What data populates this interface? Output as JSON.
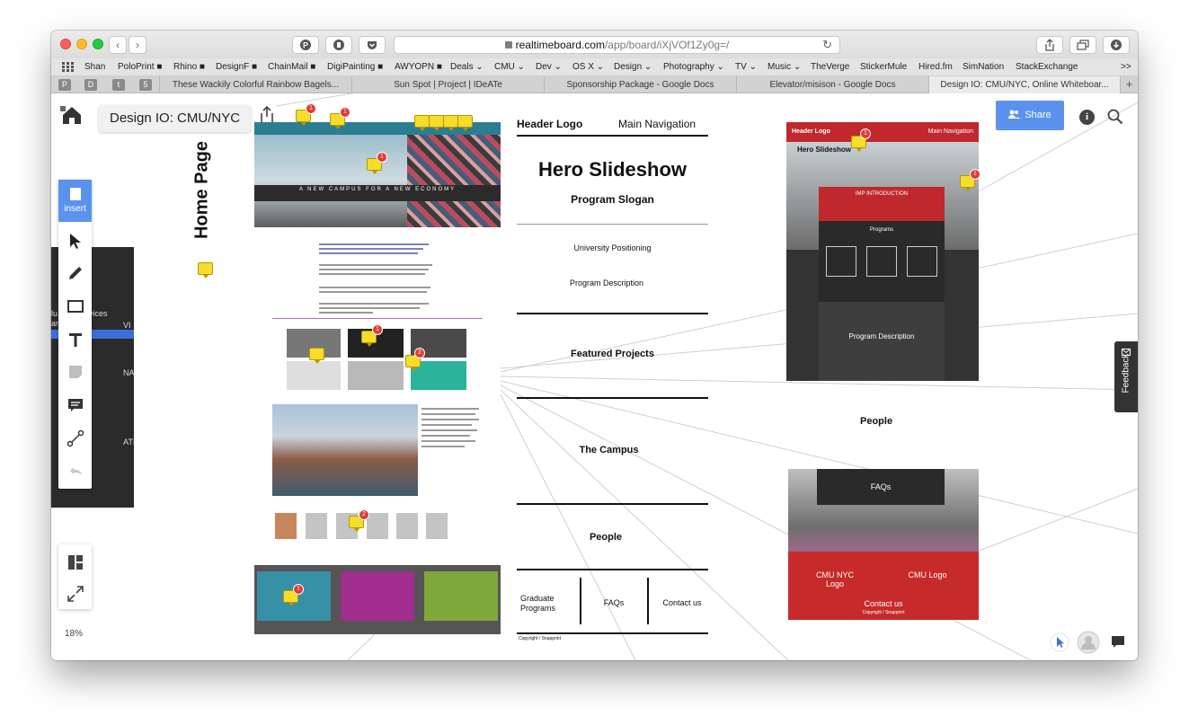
{
  "browser": {
    "address": {
      "host": "realtimeboard.com",
      "path": "/app/board/iXjVOf1Zy0g=/"
    },
    "bookmarks": [
      "Shan",
      "PoloPrint ■",
      "Rhino ■",
      "DesignF ■",
      "ChainMail ■",
      "DigiPainting ■",
      "AWYOPN ■",
      "Deals ⌄",
      "CMU ⌄",
      "Dev ⌄",
      "OS X ⌄",
      "Design ⌄",
      "Photography ⌄",
      "TV ⌄",
      "Music ⌄",
      "TheVerge",
      "StickerMule",
      "Hired.fm",
      "SimNation",
      "StackExchange",
      ">>"
    ],
    "pinned_tabs": [
      "P",
      "D",
      "t",
      "5"
    ],
    "tabs": [
      "These Wackily Colorful Rainbow Bagels...",
      "Sun Spot | Project | IDeATe",
      "Sponsorship Package - Google Docs",
      "Elevator/misison - Google Docs",
      "Design IO: CMU/NYC, Online Whiteboar..."
    ],
    "active_tab": 4
  },
  "board": {
    "title": "Design IO: CMU/NYC",
    "share_label": "Share",
    "insert_label": "insert",
    "zoom": "18%",
    "feedback_label": "Feedback",
    "homepage_label": "Home Page",
    "side_panel": {
      "services": "vices",
      "lu": "lu",
      "an": "an",
      "vi": "VI",
      "na": "NA",
      "ati": "ATI"
    }
  },
  "site_mockup": {
    "hero_tagline": "A NEW CAMPUS FOR A NEW ECONOMY",
    "comment_counts": [
      "1",
      "1",
      "1",
      "1",
      "2",
      "2",
      "1"
    ]
  },
  "wireframe": {
    "header_logo": "Header Logo",
    "main_nav": "Main Navigation",
    "hero": "Hero Slideshow",
    "slogan": "Program Slogan",
    "positioning": "University Positioning",
    "description": "Program Description",
    "featured": "Featured Projects",
    "campus": "The Campus",
    "people": "People",
    "footer_graduate": "Graduate Programs",
    "footer_faqs": "FAQs",
    "footer_contact": "Contact us",
    "copyright": "Copyright / Snapprint"
  },
  "mobile_mockup": {
    "header_logo": "Header Logo",
    "main_nav": "Main Navigation",
    "hero": "Hero Slideshow",
    "intro": "IMP INTRODUCTION",
    "programs": "Programs",
    "description": "Program Description",
    "comment_counts": [
      "1",
      "1"
    ]
  },
  "people_label": "People",
  "mobile_footer": {
    "faqs": "FAQs",
    "cmu_nyc_logo": "CMU NYC Logo",
    "cmu_logo": "CMU Logo",
    "contact": "Contact us",
    "copyright": "Copyright / Snapprint"
  },
  "colors": {
    "accent": "#5b92ee",
    "brand_red": "#c0282d",
    "comment_yellow": "#f6dc2b"
  }
}
